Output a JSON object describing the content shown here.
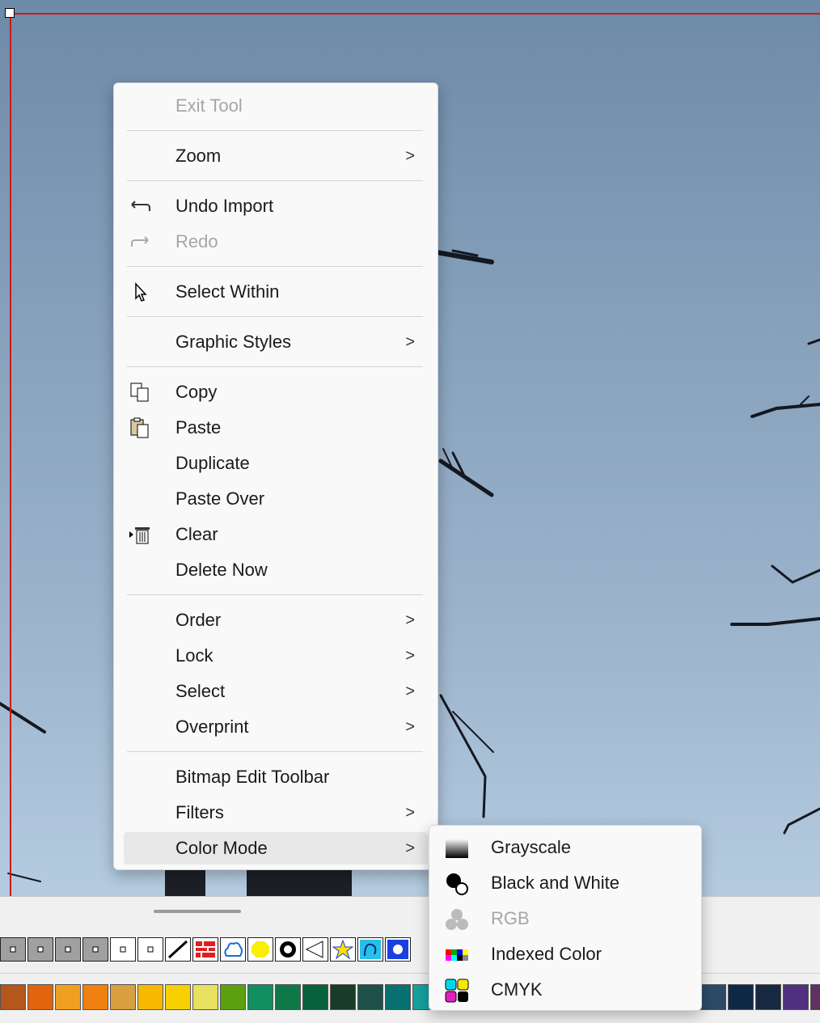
{
  "context_menu": {
    "items": [
      {
        "label": "Exit Tool",
        "disabled": true
      },
      {
        "label": "Zoom",
        "submenu": true
      },
      {
        "label": "Undo Import",
        "icon": "undo-icon"
      },
      {
        "label": "Redo",
        "icon": "redo-icon",
        "disabled": true
      },
      {
        "label": "Select Within",
        "icon": "select-within-cursor-icon"
      },
      {
        "label": "Graphic Styles",
        "submenu": true
      },
      {
        "label": "Copy",
        "icon": "copy-icon"
      },
      {
        "label": "Paste",
        "icon": "paste-icon"
      },
      {
        "label": "Duplicate"
      },
      {
        "label": "Paste Over"
      },
      {
        "label": "Clear",
        "icon": "trash-icon"
      },
      {
        "label": "Delete Now"
      },
      {
        "label": "Order",
        "submenu": true
      },
      {
        "label": "Lock",
        "submenu": true
      },
      {
        "label": "Select",
        "submenu": true
      },
      {
        "label": "Overprint",
        "submenu": true
      },
      {
        "label": "Bitmap Edit Toolbar"
      },
      {
        "label": "Filters",
        "submenu": true
      },
      {
        "label": "Color Mode",
        "submenu": true,
        "highlighted": true
      }
    ],
    "arrow_glyph": ">"
  },
  "color_mode_submenu": {
    "items": [
      {
        "label": "Grayscale",
        "icon": "grayscale-gradient-icon"
      },
      {
        "label": "Black and White",
        "icon": "black-white-circles-icon"
      },
      {
        "label": "RGB",
        "icon": "rgb-circles-icon",
        "disabled": true
      },
      {
        "label": "Indexed Color",
        "icon": "indexed-color-palette-icon"
      },
      {
        "label": "CMYK",
        "icon": "cmyk-circles-icon"
      }
    ]
  },
  "colors": {
    "selection_frame": "#d01818",
    "menu_background": "#f9f9f9",
    "disabled_text": "#a6a6a6",
    "hover_background": "#e8e8e8"
  },
  "swatches": [
    "#b5561c",
    "#e2640f",
    "#f0a020",
    "#f08010",
    "#d8a040",
    "#f8b800",
    "#f8d000",
    "#e8e060",
    "#5ca010",
    "#109060",
    "#107848",
    "#08603c",
    "#183c28",
    "#1c5048",
    "#087070",
    "#18a0a0"
  ],
  "swatches_right": [
    "#2c4a68",
    "#102848",
    "#182840",
    "#503080",
    "#603060"
  ]
}
